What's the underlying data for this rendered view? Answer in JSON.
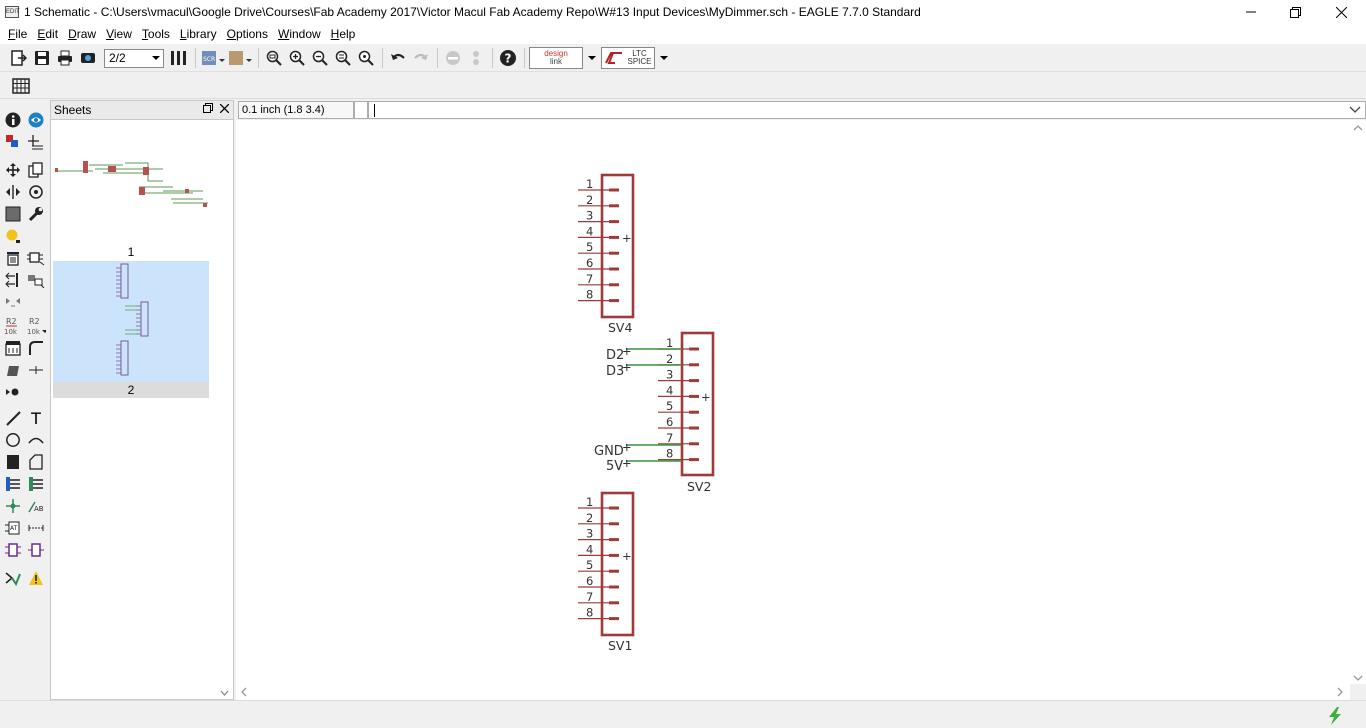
{
  "window": {
    "title": "1 Schematic - C:\\Users\\vmacul\\Google Drive\\Courses\\Fab Academy 2017\\Victor Macul Fab Academy Repo\\W#13 Input Devices\\MyDimmer.sch - EAGLE 7.7.0 Standard",
    "icon_text": "EDIT"
  },
  "menu": {
    "items": [
      {
        "first": "F",
        "rest": "ile"
      },
      {
        "first": "E",
        "rest": "dit"
      },
      {
        "first": "D",
        "rest": "raw"
      },
      {
        "first": "V",
        "rest": "iew"
      },
      {
        "first": "T",
        "rest": "ools"
      },
      {
        "first": "L",
        "rest": "ibrary"
      },
      {
        "first": "O",
        "rest": "ptions"
      },
      {
        "first": "W",
        "rest": "indow"
      },
      {
        "first": "H",
        "rest": "elp"
      }
    ]
  },
  "toolbar": {
    "sheet_selector": "2/2",
    "design_link": {
      "line1": "design",
      "line2": "link"
    },
    "ltspice": {
      "line1": "LTC",
      "line2": "SPICE"
    }
  },
  "palette": {
    "value_label_top": "R2",
    "value_label_bottom_1": "10k",
    "value_label_bottom_2": "10k",
    "text_tool": "T"
  },
  "sheets_panel": {
    "title": "Sheets",
    "sheets": [
      {
        "number": "1",
        "selected": false
      },
      {
        "number": "2",
        "selected": true
      }
    ]
  },
  "coordinates": "0.1 inch (1.8 3.4)",
  "command_line": {
    "value": ""
  },
  "schematic": {
    "parts": [
      {
        "name": "SV4",
        "pins": [
          "1",
          "2",
          "3",
          "4",
          "5",
          "6",
          "7",
          "8"
        ]
      },
      {
        "name": "SV2",
        "pins": [
          "1",
          "2",
          "3",
          "4",
          "5",
          "6",
          "7",
          "8"
        ]
      },
      {
        "name": "SV1",
        "pins": [
          "1",
          "2",
          "3",
          "4",
          "5",
          "6",
          "7",
          "8"
        ]
      }
    ],
    "nets": {
      "d2": "D2",
      "d3": "D3",
      "gnd": "GND",
      "vcc": "5V"
    },
    "colors": {
      "symbol": "#9e3a3a",
      "net": "#3d8f3d"
    }
  }
}
